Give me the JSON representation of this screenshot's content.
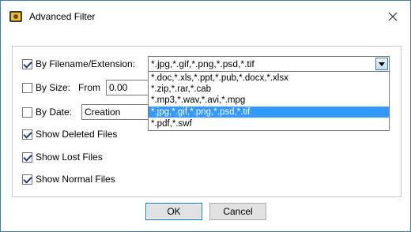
{
  "window": {
    "title": "Advanced Filter"
  },
  "filters": {
    "by_filename": {
      "label": "By Filename/Extension:",
      "checked": true,
      "value": "*.jpg,*.gif,*.png,*.psd,*.tif"
    },
    "by_size": {
      "label": "By Size:",
      "checked": false,
      "from_label": "From",
      "from_value": "0.00"
    },
    "by_date": {
      "label": "By Date:",
      "checked": false,
      "date_type": "Creation"
    },
    "show_deleted": {
      "label": "Show Deleted Files",
      "checked": true
    },
    "show_lost": {
      "label": "Show Lost Files",
      "checked": true
    },
    "show_normal": {
      "label": "Show Normal Files",
      "checked": true
    }
  },
  "dropdown": {
    "options": [
      "*.doc,*.xls,*.ppt,*.pub,*.docx,*.xlsx",
      "*.zip,*.rar,*.cab",
      "*.mp3,*.wav,*.avi,*.mpg",
      "*.jpg,*.gif,*.png,*.psd,*.tif",
      "*.pdf,*.swf"
    ],
    "selected_index": 3
  },
  "buttons": {
    "ok": "OK",
    "cancel": "Cancel"
  },
  "colors": {
    "selection": "#3399ff",
    "accent": "#0078d7"
  }
}
